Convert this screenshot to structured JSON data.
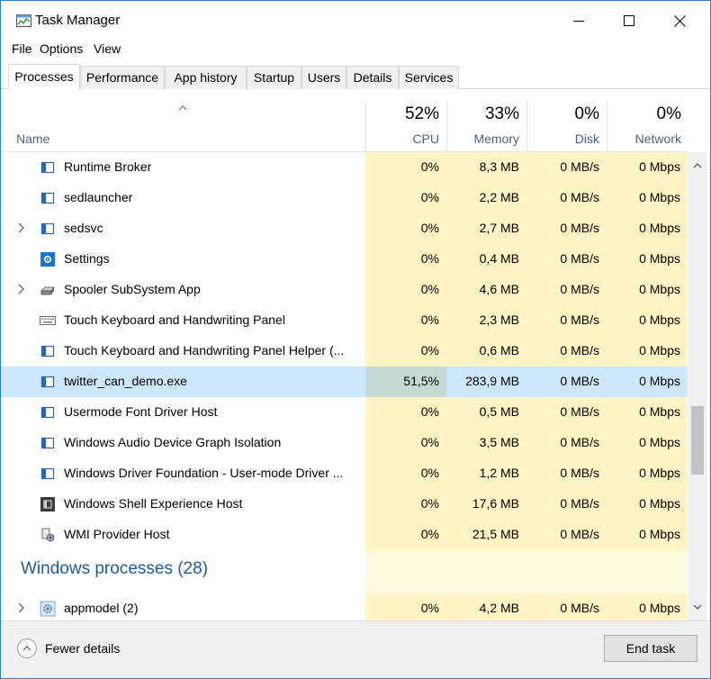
{
  "window": {
    "title": "Task Manager"
  },
  "menu": [
    "File",
    "Options",
    "View"
  ],
  "tabs": [
    "Processes",
    "Performance",
    "App history",
    "Startup",
    "Users",
    "Details",
    "Services"
  ],
  "columns": {
    "name": "Name",
    "cpu": {
      "percent": "52%",
      "label": "CPU"
    },
    "memory": {
      "percent": "33%",
      "label": "Memory"
    },
    "disk": {
      "percent": "0%",
      "label": "Disk"
    },
    "network": {
      "percent": "0%",
      "label": "Network"
    }
  },
  "rows": [
    {
      "name": "Runtime Broker",
      "icon": "app-window-icon",
      "expandable": false,
      "cpu": "0%",
      "memory": "8,3 MB",
      "disk": "0 MB/s",
      "network": "0 Mbps"
    },
    {
      "name": "sedlauncher",
      "icon": "app-window-icon",
      "expandable": false,
      "cpu": "0%",
      "memory": "2,2 MB",
      "disk": "0 MB/s",
      "network": "0 Mbps"
    },
    {
      "name": "sedsvc",
      "icon": "app-window-icon",
      "expandable": true,
      "cpu": "0%",
      "memory": "2,7 MB",
      "disk": "0 MB/s",
      "network": "0 Mbps"
    },
    {
      "name": "Settings",
      "icon": "settings-gear-icon",
      "expandable": false,
      "cpu": "0%",
      "memory": "0,4 MB",
      "disk": "0 MB/s",
      "network": "0 Mbps"
    },
    {
      "name": "Spooler SubSystem App",
      "icon": "printer-icon",
      "expandable": true,
      "cpu": "0%",
      "memory": "4,6 MB",
      "disk": "0 MB/s",
      "network": "0 Mbps"
    },
    {
      "name": "Touch Keyboard and Handwriting Panel",
      "icon": "keyboard-icon",
      "expandable": false,
      "cpu": "0%",
      "memory": "2,3 MB",
      "disk": "0 MB/s",
      "network": "0 Mbps"
    },
    {
      "name": "Touch Keyboard and Handwriting Panel Helper (...",
      "icon": "app-window-icon",
      "expandable": false,
      "cpu": "0%",
      "memory": "0,6 MB",
      "disk": "0 MB/s",
      "network": "0 Mbps"
    },
    {
      "name": "twitter_can_demo.exe",
      "icon": "app-window-icon",
      "expandable": false,
      "selected": true,
      "cpu": "51,5%",
      "memory": "283,9 MB",
      "disk": "0 MB/s",
      "network": "0 Mbps"
    },
    {
      "name": "Usermode Font Driver Host",
      "icon": "app-window-icon",
      "expandable": false,
      "cpu": "0%",
      "memory": "0,5 MB",
      "disk": "0 MB/s",
      "network": "0 Mbps"
    },
    {
      "name": "Windows Audio Device Graph Isolation",
      "icon": "app-window-icon",
      "expandable": false,
      "cpu": "0%",
      "memory": "3,5 MB",
      "disk": "0 MB/s",
      "network": "0 Mbps"
    },
    {
      "name": "Windows Driver Foundation - User-mode Driver ...",
      "icon": "app-window-icon",
      "expandable": false,
      "cpu": "0%",
      "memory": "1,2 MB",
      "disk": "0 MB/s",
      "network": "0 Mbps"
    },
    {
      "name": "Windows Shell Experience Host",
      "icon": "dark-app-icon",
      "expandable": false,
      "cpu": "0%",
      "memory": "17,6 MB",
      "disk": "0 MB/s",
      "network": "0 Mbps"
    },
    {
      "name": "WMI Provider Host",
      "icon": "wmi-host-icon",
      "expandable": false,
      "cpu": "0%",
      "memory": "21,5 MB",
      "disk": "0 MB/s",
      "network": "0 Mbps"
    }
  ],
  "group": {
    "title": "Windows processes (28)"
  },
  "group_rows": [
    {
      "name": "appmodel (2)",
      "icon": "settings-cog-icon",
      "expandable": true,
      "cpu": "0%",
      "memory": "4,2 MB",
      "disk": "0 MB/s",
      "network": "0 Mbps"
    }
  ],
  "footer": {
    "fewer_details": "Fewer details",
    "end_task": "End task"
  },
  "colors": {
    "heat": "#fff4c4",
    "selected": "#cce8ff",
    "group_title": "#1e5aa8",
    "accent_border": "#2b7cd3"
  }
}
